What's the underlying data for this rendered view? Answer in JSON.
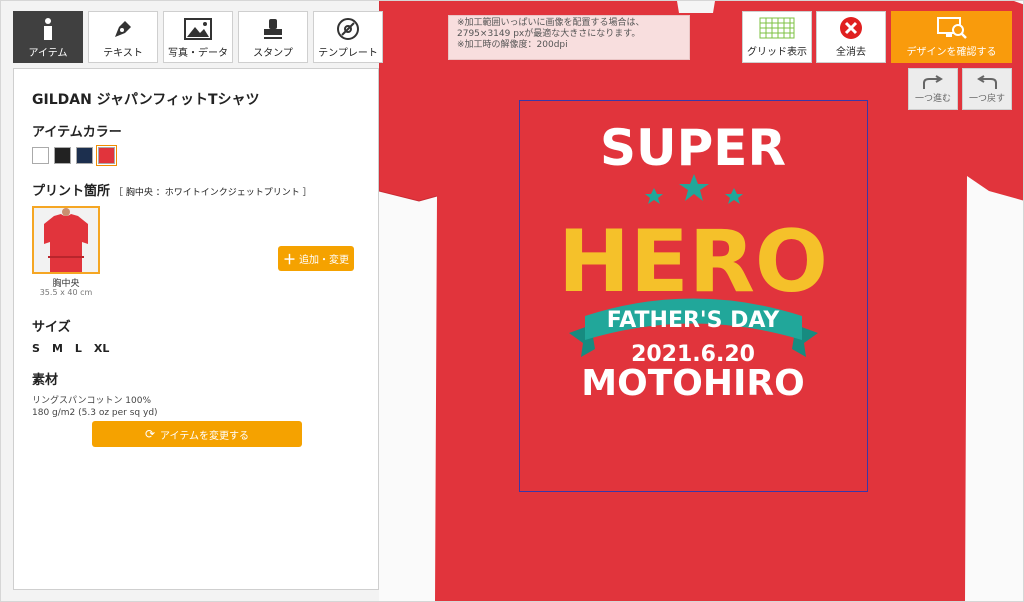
{
  "toolbar": {
    "items": [
      {
        "label": "アイテム",
        "icon": "info-icon"
      },
      {
        "label": "テキスト",
        "icon": "pen-icon"
      },
      {
        "label": "写真・データ",
        "icon": "image-icon"
      },
      {
        "label": "スタンプ",
        "icon": "stamp-icon"
      },
      {
        "label": "テンプレート",
        "icon": "template-icon"
      }
    ]
  },
  "product": {
    "title": "GILDAN ジャパンフィットTシャツ",
    "color_heading": "アイテムカラー",
    "colors": [
      "#ffffff",
      "#222222",
      "#1c2f4e",
      "#e1343c"
    ],
    "selected_color": "#e1343c",
    "print_heading": "プリント箇所",
    "print_subheading": "［ 胸中央 ：ホワイトインクジェットプリント ］",
    "print_location": "胸中央",
    "print_size": "35.5 x 40 cm",
    "add_change_label": "追加・変更",
    "size_heading": "サイズ",
    "sizes": [
      "S",
      "M",
      "L",
      "XL"
    ],
    "material_heading": "素材",
    "material_line1": "リングスパンコットン 100%",
    "material_line2": "180 g/m2 (5.3 oz per sq yd)",
    "change_item_label": "アイテムを変更する"
  },
  "notice": {
    "line1": "※加工範囲いっぱいに画像を配置する場合は、",
    "line2": "2795×3149 pxが最適な大きさになります。",
    "line3": "※加工時の解像度：200dpi"
  },
  "actions": {
    "grid_label": "グリッド表示",
    "clear_label": "全消去",
    "confirm_label": "デザインを確認する",
    "redo_label": "一つ進む",
    "undo_label": "一つ戻す"
  },
  "design": {
    "line1": "SUPER",
    "line2": "HERO",
    "banner": "FATHER'S DAY",
    "date": "2021.6.20",
    "name": "MOTOHIRO"
  },
  "colors": {
    "shirt": "#e1343c",
    "accent": "#f99b0c",
    "teal": "#21a79a",
    "yellow": "#f5c12a"
  }
}
